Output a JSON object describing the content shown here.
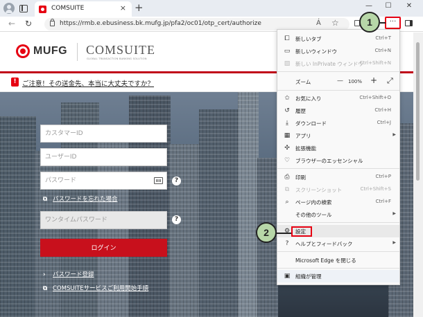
{
  "browser": {
    "tab_title": "COMSUITE",
    "tab_close": "×",
    "new_tab": "+",
    "url": "https://rmb.e.ebusiness.bk.mufg.jp/pfa2/oc01/otp_cert/authorize",
    "more_button": "···",
    "read_aloud": "A̒",
    "favorite": "☆",
    "window_minimize": "—",
    "window_maximize": "☐",
    "window_close": "✕",
    "back": "←",
    "refresh": "↻"
  },
  "header": {
    "brand": "MUFG",
    "product": "COMSUITE",
    "product_sub": "GLOBAL TRANSACTION BANKING SOLUTION"
  },
  "notice": {
    "icon": "!",
    "text": "ご注意！その送金先、本当に大丈夫ですか？"
  },
  "login": {
    "customer_id_placeholder": "カスタマーID",
    "user_id_placeholder": "ユーザーID",
    "password_placeholder": "パスワード",
    "forgot_password": "パスワードを忘れた場合",
    "otp_placeholder": "ワンタイムパスワード",
    "login_button": "ログイン",
    "register_password": "パスワード登録",
    "service_guide": "COMSUITEサービスご利用開始手順",
    "help": "?"
  },
  "menu": {
    "items": [
      {
        "label": "新しいタブ",
        "shortcut": "Ctrl+T",
        "icon": "new-tab-icon"
      },
      {
        "label": "新しいウィンドウ",
        "shortcut": "Ctrl+N",
        "icon": "new-window-icon"
      },
      {
        "label": "新しい InPrivate ウィンドウ",
        "shortcut": "Ctrl+Shift+N",
        "icon": "inprivate-icon"
      },
      {
        "label": "ズーム",
        "zoom_value": "100%",
        "zoom_minus": "—",
        "zoom_plus": "+",
        "zoom_expand": "⤢"
      },
      {
        "label": "お気に入り",
        "shortcut": "Ctrl+Shift+O",
        "icon": "favorites-icon"
      },
      {
        "label": "履歴",
        "shortcut": "Ctrl+H",
        "icon": "history-icon"
      },
      {
        "label": "ダウンロード",
        "shortcut": "Ctrl+J",
        "icon": "download-icon"
      },
      {
        "label": "アプリ",
        "icon": "apps-icon"
      },
      {
        "label": "拡張機能",
        "icon": "extensions-icon"
      },
      {
        "label": "ブラウザーのエッセンシャル",
        "icon": "essentials-icon"
      },
      {
        "label": "印刷",
        "shortcut": "Ctrl+P",
        "icon": "print-icon"
      },
      {
        "label": "スクリーンショット",
        "shortcut": "Ctrl+Shift+S",
        "icon": "screenshot-icon"
      },
      {
        "label": "ページ内の検索",
        "shortcut": "Ctrl+F",
        "icon": "find-icon"
      },
      {
        "label": "その他のツール",
        "icon": ""
      },
      {
        "label": "設定",
        "icon": "gear-icon"
      },
      {
        "label": "ヘルプとフィードバック",
        "icon": "help-icon"
      },
      {
        "label": "Microsoft Edge を閉じる",
        "icon": ""
      },
      {
        "label": "組織が管理",
        "icon": "organization-icon"
      }
    ]
  },
  "callouts": {
    "one": "1",
    "two": "2"
  },
  "colors": {
    "accent_red": "#e60012",
    "callout_green": "#b7d7a8",
    "login_red": "#c8101c"
  }
}
